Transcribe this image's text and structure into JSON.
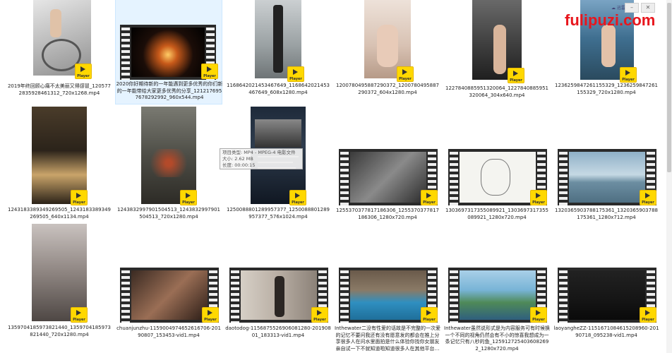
{
  "colors": {
    "badge": "#ffd800",
    "watermark": "#e8161d",
    "selection": "#e5f3ff"
  },
  "badge_label": "Player",
  "watermark": "fulipuzi.com",
  "logo_text": "迅雷",
  "tooltip": {
    "type": "项目类型: MP4 - MPEG-4 电影文件",
    "size": "大小: 2.62 MB",
    "duration": "长度: 00:00:15"
  },
  "items": [
    {
      "name": "2019年终回顾心痛不太美丽又得感冒_1205772835928461312_720x1268.mp4"
    },
    {
      "name": "2020你好期待新的一年能遇到更多优秀的你们新的一年能带给大家更多优秀的分享_1212176957678292992_960x544.mp4"
    },
    {
      "name": "1168642021453467649_1168642021453467649_608x1280.mp4"
    },
    {
      "name": "1200780495887290372_1200780495887290372_604x1280.mp4"
    },
    {
      "name": "1227840885951320064_1227840885951320064_304x640.mp4"
    },
    {
      "name": "1236259847261155329_1236259847261155329_720x1280.mp4"
    },
    {
      "name": "1243183389349269505_1243183389349269505_640x1134.mp4"
    },
    {
      "name": "1243832997901504513_1243832997901504513_720x1280.mp4"
    },
    {
      "name": "1250088801289957377_1250088801289957377_576x1024.mp4"
    },
    {
      "name": "1255370377817186306_1255370377817186306_1280x720.mp4"
    },
    {
      "name": "1303697317355089921_1303697317355089921_1280x720.mp4"
    },
    {
      "name": "1320365903788175361_1320365903788175361_1280x712.mp4"
    },
    {
      "name": "1359704185973821440_1359704185973821440_720x1280.mp4"
    },
    {
      "name": "chuanjunzhu-1159004974652616706-20190807_153453-vid1.mp4"
    },
    {
      "name": "daotodog-1156875526906081280-20190801_183313-vid1.mp4"
    },
    {
      "name": "Inthewater二没有性爱的话故是不完整的一次爱的记忆不要问我还有没有愿意发的都会在推上分享很多人在问水里面拍是什么体验你找你女朋友亲自试一下不就知道啦知道很多人在其他平台…"
    },
    {
      "name": "Inthewater虽然说形式是为内容服务可有时候换一个不同的视角仍然会有不小的惊喜我想成为一条记忆只有八秒的鱼_1259127254036082692_1280x720.mp4"
    },
    {
      "name": "laoyangheZZ-1151671084615208960-20190718_095238-vid1.mp4"
    }
  ]
}
